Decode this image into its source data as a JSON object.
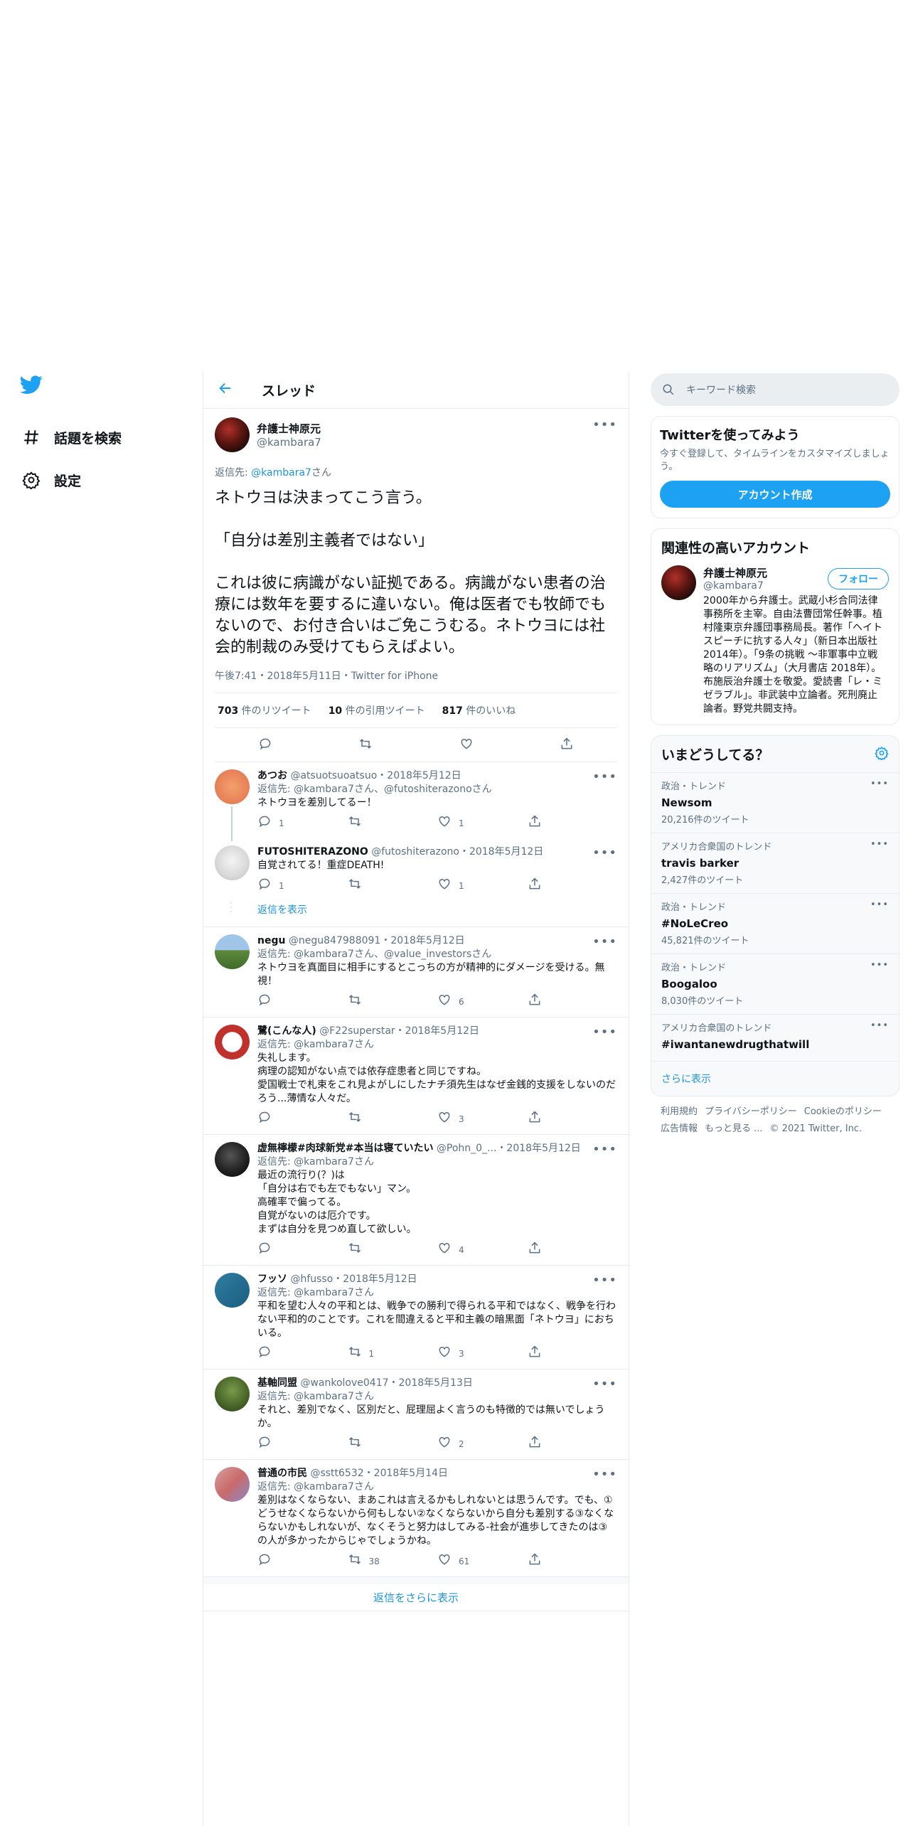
{
  "nav": {
    "explore": "話題を検索",
    "settings": "設定"
  },
  "header": {
    "title": "スレッド"
  },
  "main_tweet": {
    "name": "弁護士神原元",
    "handle": "@kambara7",
    "reply_prefix": "返信先: ",
    "reply_to": "@kambara7",
    "reply_suffix": "さん",
    "text": "ネトウヨは決まってこう言う。\n\n「自分は差別主義者ではない」\n\nこれは彼に病識がない証拠である。病識がない患者の治療には数年を要するに違いない。俺は医者でも牧師でもないので、お付き合いはご免こうむる。ネトウヨには社会的制裁のみ受けてもらえばよい。",
    "meta": "午後7:41・2018年5月11日・Twitter for iPhone",
    "retweets": "703",
    "retweets_label": " 件のリツイート",
    "quotes": "10",
    "quotes_label": " 件の引用ツイート",
    "likes": "817",
    "likes_label": " 件のいいね"
  },
  "replies": [
    {
      "name": "あつお",
      "handle": "@atsuotsuoatsuo",
      "date": "・2018年5月12日",
      "reply": "返信先: @kambara7さん、@futoshiterazonoさん",
      "text": "ネトウヨを差別してるー！",
      "replies": "1",
      "retweets": "",
      "likes": "1"
    },
    {
      "name": "FUTOSHITERAZONO",
      "handle": "@futoshiterazono",
      "date": "・2018年5月12日",
      "reply": "",
      "text": "自覚されてる！重症DEATH!",
      "replies": "1",
      "retweets": "",
      "likes": "1"
    },
    {
      "name": "negu",
      "handle": "@negu847988091",
      "date": "・2018年5月12日",
      "reply": "返信先: @kambara7さん、@value_investorsさん",
      "text": "ネトウヨを真面目に相手にするとこっちの方が精神的にダメージを受ける。無視！",
      "replies": "",
      "retweets": "",
      "likes": "6"
    },
    {
      "name": "鷺(こんな人)",
      "handle": "@F22superstar",
      "date": "・2018年5月12日",
      "reply": "返信先: @kambara7さん",
      "text": "失礼します。\n病理の認知がない点では依存症患者と同じですね。\n愛国戦士で札束をこれ見よがしにしたナチ須先生はなぜ金銭的支援をしないのだろう...薄情な人々だ。",
      "replies": "",
      "retweets": "",
      "likes": "3"
    },
    {
      "name": "虚無檸檬#肉球新党#本当は寝ていたい",
      "handle": "@Pohn_0_...",
      "date": "・2018年5月12日",
      "reply": "返信先: @kambara7さん",
      "text": "最近の流行り(？)は\n「自分は右でも左でもない」マン。\n高確率で偏ってる。\n自覚がないのは厄介です。\nまずは自分を見つめ直して欲しい。",
      "replies": "",
      "retweets": "",
      "likes": "4"
    },
    {
      "name": "フッソ",
      "handle": "@hfusso",
      "date": "・2018年5月12日",
      "reply": "返信先: @kambara7さん",
      "text": "平和を望む人々の平和とは、戦争での勝利で得られる平和ではなく、戦争を行わない平和的のことです。これを間違えると平和主義の暗黒面「ネトウヨ」におちいる。",
      "replies": "",
      "retweets": "1",
      "likes": "3"
    },
    {
      "name": "基軸同盟",
      "handle": "@wankolove0417",
      "date": "・2018年5月13日",
      "reply": "返信先: @kambara7さん",
      "text": "それと、差別でなく、区別だと、屁理屈よく言うのも特徴的では無いでしょうか。",
      "replies": "",
      "retweets": "",
      "likes": "2"
    },
    {
      "name": "普通の市民",
      "handle": "@sstt6532",
      "date": "・2018年5月14日",
      "reply": "返信先: @kambara7さん",
      "text": "差別はなくならない、まあこれは言えるかもしれないとは思うんです。でも、①どうせなくならないから何もしない②なくならないから自分も差別する③なくならないかもしれないが、なくそうと努力はしてみる-社会が進歩してきたのは③の人が多かったからじゃでしょうかね。",
      "replies": "",
      "retweets": "38",
      "likes": "61"
    }
  ],
  "show_replies": "返信を表示",
  "more_replies": "返信をさらに表示",
  "sidebar": {
    "search_placeholder": "キーワード検索",
    "signup": {
      "title": "Twitterを使ってみよう",
      "desc": "今すぐ登録して、タイムラインをカスタマイズしましょう。",
      "button": "アカウント作成"
    },
    "related": {
      "title": "関連性の高いアカウント",
      "name": "弁護士神原元",
      "handle": "@kambara7",
      "follow": "フォロー",
      "bio": "2000年から弁護士。武蔵小杉合同法律事務所を主宰。自由法曹団常任幹事。植村隆東京弁護団事務局長。著作「ヘイトスピーチに抗する人々」（新日本出版社2014年）。「9条の挑戦 ～非軍事中立戦略のリアリズム」（大月書店 2018年）。布施辰治弁護士を敬愛。愛読書「レ・ミゼラブル」。非武装中立論者。死刑廃止論者。野党共闘支持。"
    },
    "trends": {
      "title": "いまどうしてる？",
      "items": [
        {
          "ctx": "政治・トレンド",
          "name": "Newsom",
          "count": "20,216件のツイート"
        },
        {
          "ctx": "アメリカ合衆国のトレンド",
          "name": "travis barker",
          "count": "2,427件のツイート"
        },
        {
          "ctx": "政治・トレンド",
          "name": "#NoLeCreo",
          "count": "45,821件のツイート"
        },
        {
          "ctx": "政治・トレンド",
          "name": "Boogaloo",
          "count": "8,030件のツイート"
        },
        {
          "ctx": "アメリカ合衆国のトレンド",
          "name": "#iwantanewdrugthatwill",
          "count": ""
        }
      ],
      "show_more": "さらに表示"
    },
    "footer": {
      "terms": "利用規約",
      "privacy": "プライバシーポリシー",
      "cookie": "Cookieのポリシー",
      "ads": "広告情報",
      "more": "もっと見る ...",
      "copyright": "© 2021 Twitter, Inc."
    }
  },
  "colors": {
    "accent": "#1da1f2",
    "link": "#1b95e0"
  }
}
